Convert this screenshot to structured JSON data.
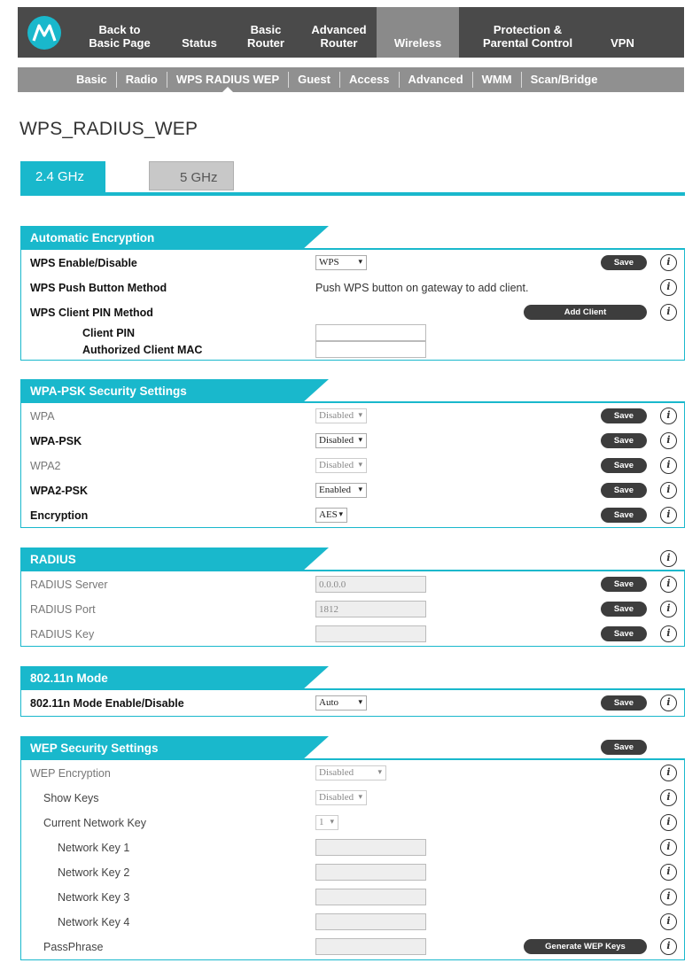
{
  "topnav": {
    "tabs": [
      {
        "line1": "Back to",
        "line2": "Basic Page"
      },
      {
        "line1": "",
        "line2": "Status"
      },
      {
        "line1": "Basic",
        "line2": "Router"
      },
      {
        "line1": "Advanced",
        "line2": "Router"
      },
      {
        "line1": "",
        "line2": "Wireless"
      },
      {
        "line1": "Protection &",
        "line2": "Parental Control"
      },
      {
        "line1": "",
        "line2": "VPN"
      }
    ],
    "active_tab": "Wireless",
    "logo_icon": "motorola-logo-icon"
  },
  "subnav": {
    "items": [
      "Basic",
      "Radio",
      "WPS RADIUS WEP",
      "Guest",
      "Access",
      "Advanced",
      "WMM",
      "Scan/Bridge"
    ],
    "active": "WPS RADIUS WEP"
  },
  "page_title": "WPS_RADIUS_WEP",
  "band_tabs": {
    "active": "2.4 GHz",
    "inactive": "5 GHz"
  },
  "colors": {
    "accent": "#19b8cc",
    "nav_dark": "#4a4a4a",
    "nav_gray": "#909090",
    "button_dark": "#3d3d3d"
  },
  "common": {
    "save": "Save",
    "info": "i"
  },
  "auto_enc": {
    "title": "Automatic Encryption",
    "wps_label": "WPS Enable/Disable",
    "wps_value": "WPS",
    "push_label": "WPS Push Button Method",
    "push_text": "Push WPS button on gateway to add client.",
    "pin_method_label": "WPS Client PIN Method",
    "add_client": "Add Client",
    "client_pin_label": "Client PIN",
    "client_pin_value": "",
    "auth_mac_label": "Authorized Client MAC",
    "auth_mac_value": ""
  },
  "wpa": {
    "title": "WPA-PSK Security Settings",
    "rows": [
      {
        "label": "WPA",
        "value": "Disabled"
      },
      {
        "label": "WPA-PSK",
        "value": "Disabled"
      },
      {
        "label": "WPA2",
        "value": "Disabled"
      },
      {
        "label": "WPA2-PSK",
        "value": "Enabled"
      },
      {
        "label": "Encryption",
        "value": "AES"
      }
    ]
  },
  "radius": {
    "title": "RADIUS",
    "server_label": "RADIUS Server",
    "server_value": "0.0.0.0",
    "port_label": "RADIUS Port",
    "port_value": "1812",
    "key_label": "RADIUS Key",
    "key_value": ""
  },
  "mode": {
    "title": "802.11n Mode",
    "label": "802.11n Mode Enable/Disable",
    "value": "Auto"
  },
  "wep": {
    "title": "WEP Security Settings",
    "encryption_label": "WEP Encryption",
    "encryption_value": "Disabled",
    "show_keys_label": "Show Keys",
    "show_keys_value": "Disabled",
    "current_key_label": "Current Network Key",
    "current_key_value": "1",
    "keys": [
      {
        "label": "Network Key 1",
        "value": ""
      },
      {
        "label": "Network Key 2",
        "value": ""
      },
      {
        "label": "Network Key 3",
        "value": ""
      },
      {
        "label": "Network Key 4",
        "value": ""
      }
    ],
    "passphrase_label": "PassPhrase",
    "passphrase_value": "",
    "generate": "Generate WEP Keys"
  }
}
